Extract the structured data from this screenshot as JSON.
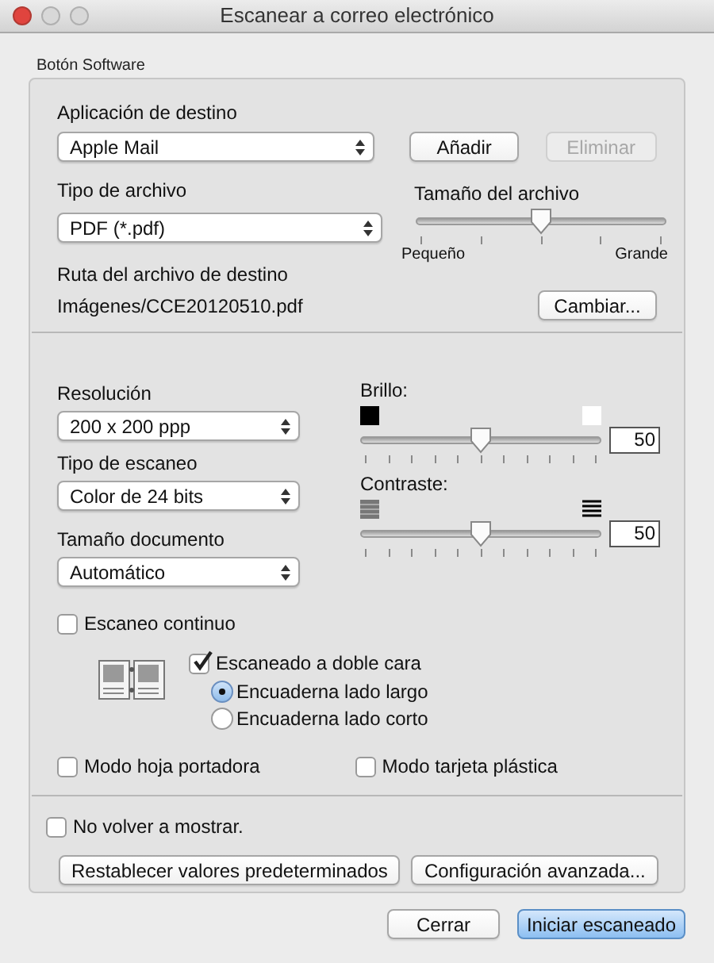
{
  "window": {
    "title": "Escanear a correo electrónico"
  },
  "group": {
    "label": "Botón Software"
  },
  "destination": {
    "label": "Aplicación de destino",
    "value": "Apple Mail",
    "buttons": [
      {
        "label": "Añadir",
        "disabled": false
      },
      {
        "label": "Eliminar",
        "disabled": true
      }
    ]
  },
  "file_type": {
    "label": "Tipo de archivo",
    "value": "PDF (*.pdf)"
  },
  "file_size": {
    "label": "Tamaño del archivo",
    "level": 0.5,
    "min_label": "Pequeño",
    "max_label": "Grande"
  },
  "path": {
    "label": "Ruta del archivo de destino",
    "value": "Imágenes/CCE20120510.pdf",
    "button": "Cambiar..."
  },
  "selects": [
    {
      "label": "Resolución",
      "value": "200 x 200 ppp"
    },
    {
      "label": "Tipo de escaneo",
      "value": "Color de 24 bits"
    },
    {
      "label": "Tamaño documento",
      "value": "Automático"
    }
  ],
  "adjustments": [
    {
      "kind": "brightness",
      "label": "Brillo:",
      "level": 0.5,
      "value": "50"
    },
    {
      "kind": "contrast",
      "label": "Contraste:",
      "level": 0.5,
      "value": "50"
    }
  ],
  "continuous": {
    "label": "Escaneo continuo",
    "checked": false
  },
  "duplex": {
    "label": "Escaneado a doble cara",
    "checked": true,
    "options": [
      {
        "label": "Encuaderna lado largo",
        "selected": true
      },
      {
        "label": "Encuaderna lado corto",
        "selected": false
      }
    ]
  },
  "modes": [
    {
      "label": "Modo hoja portadora",
      "checked": false
    },
    {
      "label": "Modo tarjeta plástica",
      "checked": false
    }
  ],
  "dont_show": {
    "label": "No volver a mostrar.",
    "checked": false
  },
  "group_buttons": [
    "Restablecer valores predeterminados",
    "Configuración avanzada..."
  ],
  "footer_buttons": [
    {
      "label": "Cerrar",
      "default": false
    },
    {
      "label": "Iniciar escaneado",
      "default": true
    }
  ]
}
